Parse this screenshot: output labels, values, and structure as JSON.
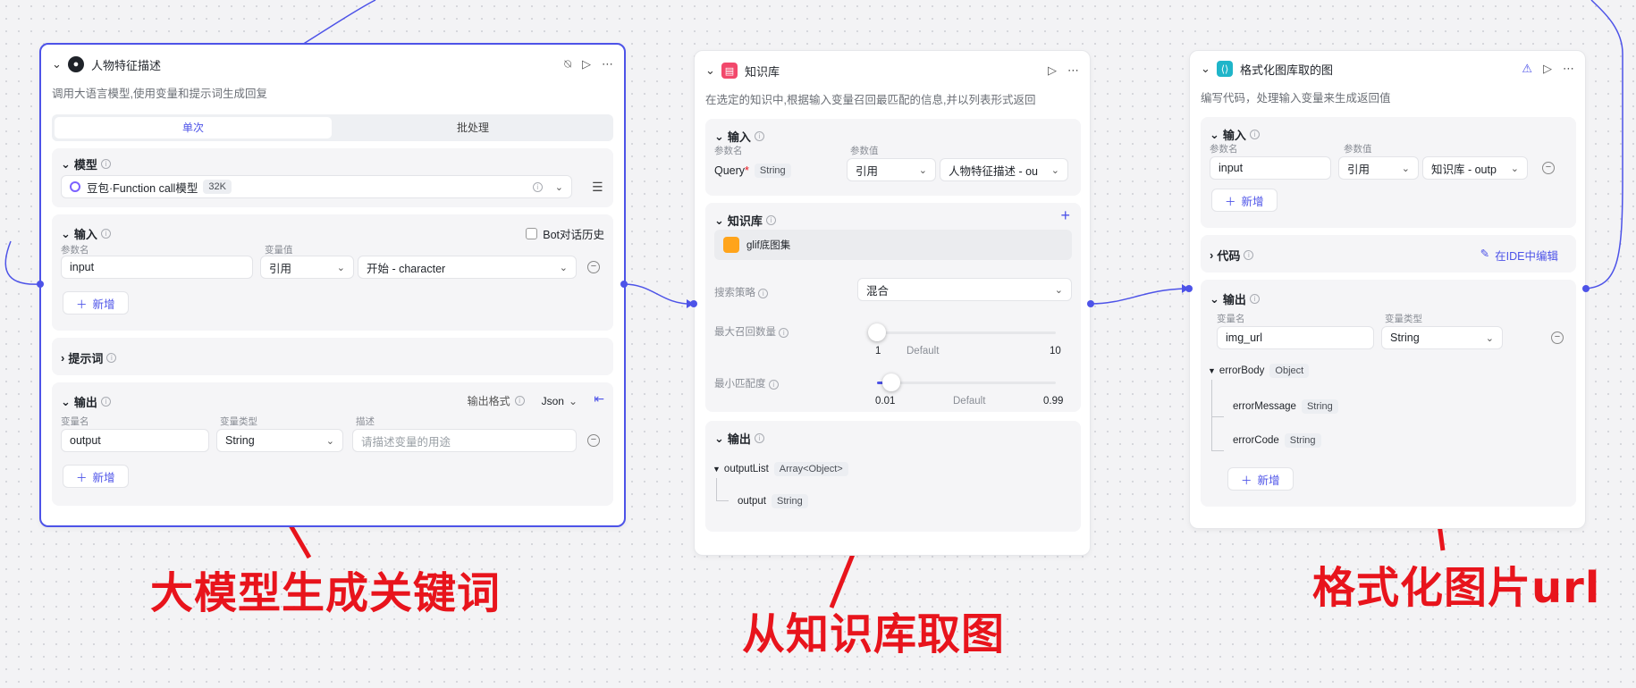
{
  "node1": {
    "title": "人物特征描述",
    "description": "调用大语言模型,使用变量和提示词生成回复",
    "tabs": [
      "单次",
      "批处理"
    ],
    "model_section": "模型",
    "model_name": "豆包·Function call模型",
    "model_badge": "32K",
    "input_section": "输入",
    "bot_history": "Bot对话历史",
    "param_name_label": "参数名",
    "var_value_label": "变量值",
    "input_param": "input",
    "ref_select": "引用",
    "ref_value": "开始 - character",
    "add_label": "新增",
    "prompt_section": "提示词",
    "output_section": "输出",
    "output_format_label": "输出格式",
    "output_format": "Json",
    "var_name_label": "变量名",
    "var_type_label": "变量类型",
    "desc_label": "描述",
    "output_var": "output",
    "output_type": "String",
    "desc_placeholder": "请描述变量的用途"
  },
  "node2": {
    "title": "知识库",
    "description": "在选定的知识中,根据输入变量召回最匹配的信息,并以列表形式返回",
    "input_section": "输入",
    "param_name_label": "参数名",
    "param_value_label": "参数值",
    "query_label": "Query",
    "query_required": "*",
    "query_type": "String",
    "ref_select": "引用",
    "ref_value": "人物特征描述 - ou",
    "kb_section": "知识库",
    "kb_item": "glif底图集",
    "strategy_label": "搜索策略",
    "strategy_value": "混合",
    "max_recall_label": "最大召回数量",
    "max_recall_min": "1",
    "max_recall_default": "Default",
    "max_recall_max": "10",
    "min_match_label": "最小匹配度",
    "min_match_min": "0.01",
    "min_match_default": "Default",
    "min_match_max": "0.99",
    "output_section": "输出",
    "output_list": "outputList",
    "output_list_type": "Array<Object>",
    "output_child": "output",
    "output_child_type": "String"
  },
  "node3": {
    "title": "格式化图库取的图",
    "description": "编写代码，处理输入变量来生成返回值",
    "input_section": "输入",
    "param_name_label": "参数名",
    "param_value_label": "参数值",
    "input_param": "input",
    "ref_select": "引用",
    "ref_value": "知识库 - outp",
    "add_label": "新增",
    "code_section": "代码",
    "ide_edit": "在IDE中编辑",
    "output_section": "输出",
    "var_name_label": "变量名",
    "var_type_label": "变量类型",
    "output_var": "img_url",
    "output_type": "String",
    "error_body": "errorBody",
    "error_body_type": "Object",
    "error_message": "errorMessage",
    "error_message_type": "String",
    "error_code": "errorCode",
    "error_code_type": "String"
  },
  "annotations": {
    "label1": "大模型生成关键词",
    "label2": "从知识库取图",
    "label3": "格式化图片url"
  },
  "colors": {
    "accent": "#4d53e8",
    "annotation": "#e8141c"
  }
}
